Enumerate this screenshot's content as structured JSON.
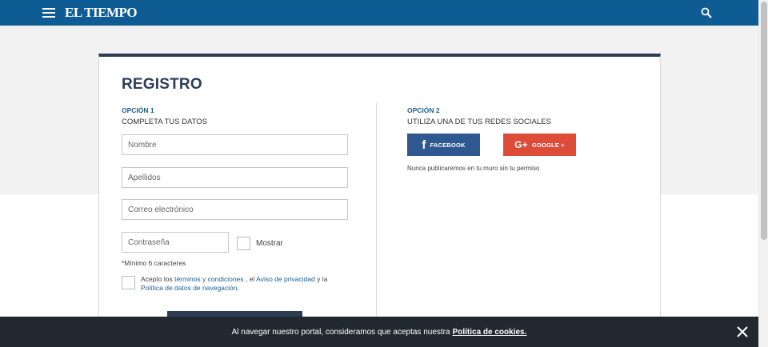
{
  "header": {
    "logo": "EL TIEMPO",
    "menu_icon": "hamburger-icon",
    "search_icon": "search-icon"
  },
  "form": {
    "title": "REGISTRO",
    "option1": {
      "label": "OPCIÓN 1",
      "subtitle": "COMPLETA TUS DATOS"
    },
    "option2": {
      "label": "OPCIÓN 2",
      "subtitle": "UTILIZA UNA DE TUS REDES SOCIALES"
    },
    "fields": {
      "nombre_placeholder": "Nombre",
      "apellidos_placeholder": "Apellidos",
      "email_placeholder": "Correo electrónico",
      "password_placeholder": "Contraseña"
    },
    "show_password_label": "Mostrar",
    "password_hint": "*Mínimo 6 caracteres",
    "terms": {
      "prefix": "Acepto los",
      "terms_link": "términos y condiciones",
      "separator": ", el",
      "privacy_link": "Aviso de privacidad",
      "conj": "y la",
      "nav_policy_link": "Política de datos de navegación."
    },
    "social": {
      "facebook_label": "FACEBOOK",
      "google_label": "GOOGLE +",
      "note": "Nunca publicaremos en tu muro sin tu permiso"
    }
  },
  "cookie_banner": {
    "text": "Al navegar nuestro portal, consideramos que aceptas nuestra",
    "link": "Política de cookies."
  },
  "colors": {
    "header_bg": "#0f5b94",
    "brand_dark": "#2c3e55",
    "facebook": "#2f5890",
    "google": "#dd4b39",
    "cookie_bg": "#22282f"
  }
}
